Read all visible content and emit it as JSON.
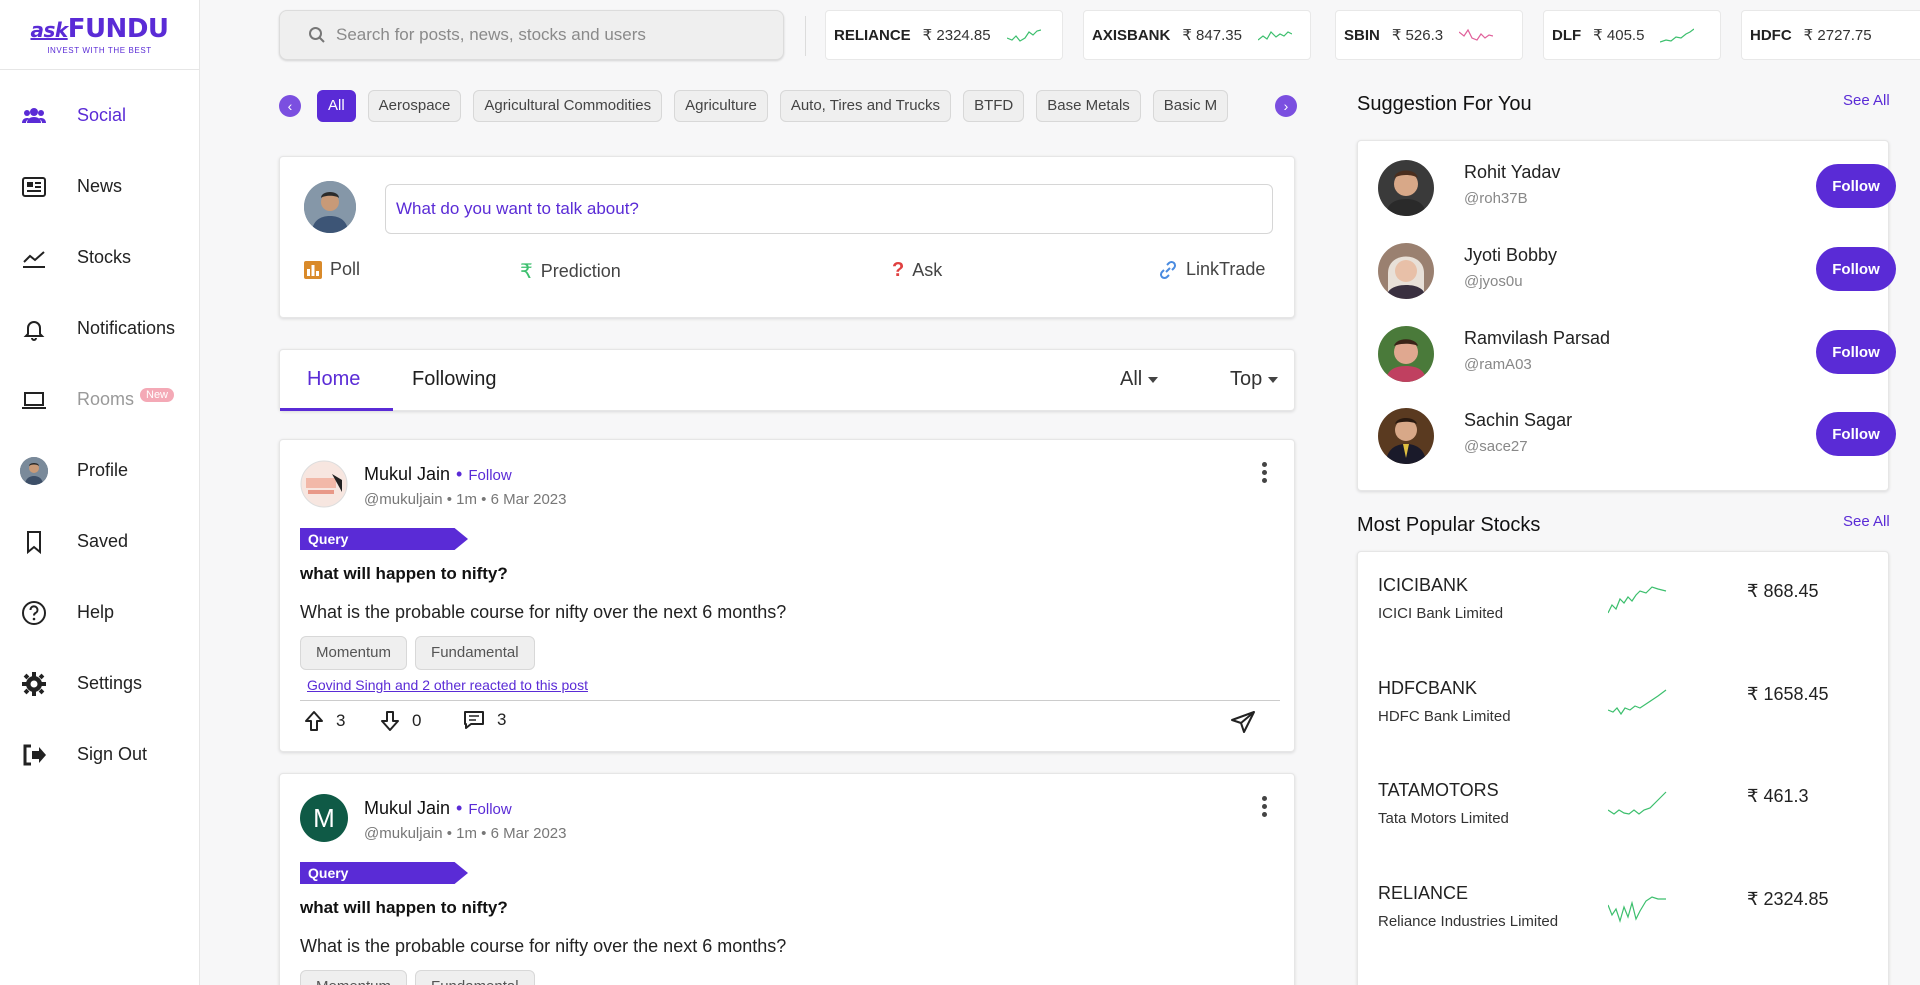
{
  "brand": {
    "logo_ask": "ask",
    "logo_main": "FUNDU",
    "tagline": "INVEST WITH THE BEST"
  },
  "sidebar": {
    "items": [
      {
        "label": "Social",
        "icon": "users-icon"
      },
      {
        "label": "News",
        "icon": "newspaper-icon"
      },
      {
        "label": "Stocks",
        "icon": "chart-line-icon"
      },
      {
        "label": "Notifications",
        "icon": "bell-icon"
      },
      {
        "label": "Rooms",
        "icon": "laptop-icon",
        "badge": "New"
      },
      {
        "label": "Profile",
        "icon": "avatar"
      },
      {
        "label": "Saved",
        "icon": "bookmark-icon"
      },
      {
        "label": "Help",
        "icon": "help-icon"
      },
      {
        "label": "Settings",
        "icon": "gear-icon"
      },
      {
        "label": "Sign Out",
        "icon": "sign-out-icon"
      }
    ]
  },
  "search": {
    "placeholder": "Search for posts, news, stocks and users"
  },
  "tickers": [
    {
      "symbol": "RELIANCE",
      "price": "₹ 2324.85"
    },
    {
      "symbol": "AXISBANK",
      "price": "₹ 847.35"
    },
    {
      "symbol": "SBIN",
      "price": "₹ 526.3"
    },
    {
      "symbol": "DLF",
      "price": "₹ 405.5"
    },
    {
      "symbol": "HDFC",
      "price": "₹ 2727.75"
    }
  ],
  "categories": [
    "All",
    "Aerospace",
    "Agricultural Commodities",
    "Agriculture",
    "Auto, Tires and Trucks",
    "BTFD",
    "Base Metals",
    "Basic M"
  ],
  "composer": {
    "placeholder": "What do you want to talk about?",
    "actions": [
      "Poll",
      "Prediction",
      "Ask",
      "LinkTrade"
    ]
  },
  "feed": {
    "tabs": [
      "Home",
      "Following"
    ],
    "filter_all": "All",
    "filter_top": "Top"
  },
  "posts": [
    {
      "author": "Mukul Jain",
      "follow": "Follow",
      "meta": "@mukuljain • 1m • 6 Mar 2023",
      "tag": "Query",
      "title": "what will happen to nifty?",
      "body": "What is the probable course for nifty over the next 6 months?",
      "topics": [
        "Momentum",
        "Fundamental"
      ],
      "reacted": "Govind Singh and 2 other reacted to this post",
      "upvotes": "3",
      "downvotes": "0",
      "comments": "3"
    },
    {
      "author": "Mukul Jain",
      "avatar_letter": "M",
      "follow": "Follow",
      "meta": "@mukuljain • 1m • 6 Mar 2023",
      "tag": "Query",
      "title": "what will happen to nifty?",
      "body": "What is the probable course for nifty over the next 6 months?",
      "topics": [
        "Momentum",
        "Fundamental"
      ]
    }
  ],
  "suggestions": {
    "title": "Suggestion For You",
    "see_all": "See All",
    "follow_label": "Follow",
    "users": [
      {
        "name": "Rohit Yadav",
        "handle": "@roh37B"
      },
      {
        "name": "Jyoti Bobby",
        "handle": "@jyos0u"
      },
      {
        "name": "Ramvilash Parsad",
        "handle": "@ramA03"
      },
      {
        "name": "Sachin Sagar",
        "handle": "@sace27"
      }
    ]
  },
  "popular": {
    "title": "Most Popular Stocks",
    "see_all": "See All",
    "stocks": [
      {
        "symbol": "ICICIBANK",
        "name": "ICICI Bank Limited",
        "price": "₹ 868.45"
      },
      {
        "symbol": "HDFCBANK",
        "name": "HDFC Bank Limited",
        "price": "₹ 1658.45"
      },
      {
        "symbol": "TATAMOTORS",
        "name": "Tata Motors Limited",
        "price": "₹ 461.3"
      },
      {
        "symbol": "RELIANCE",
        "name": "Reliance Industries Limited",
        "price": "₹ 2324.85"
      }
    ]
  },
  "colors": {
    "accent": "#5a2bd6",
    "spark_green": "#3cbf6d",
    "spark_pink": "#e0609a"
  }
}
